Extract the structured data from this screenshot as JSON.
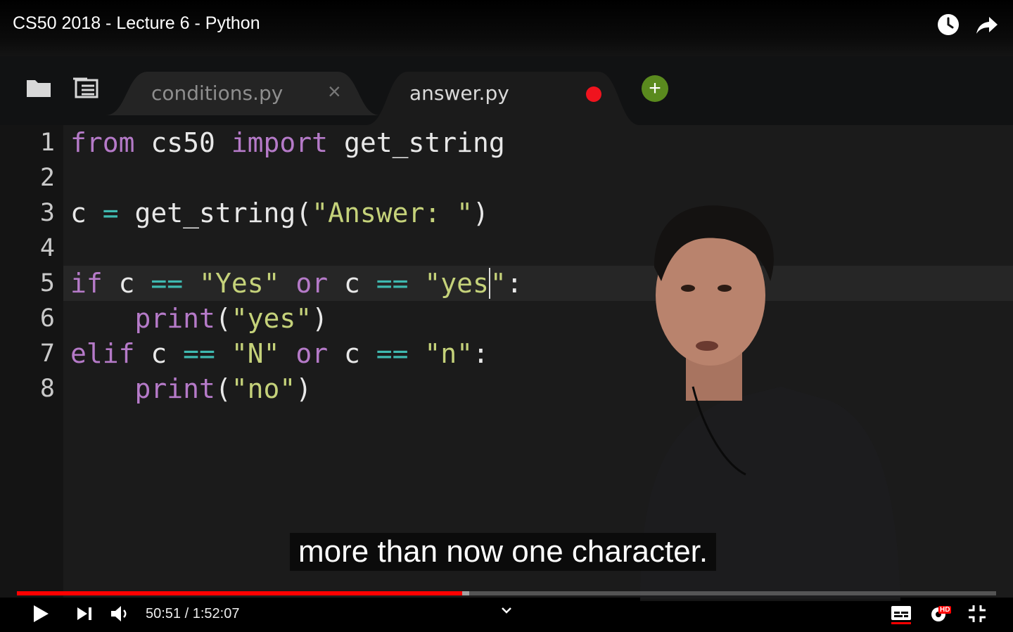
{
  "video": {
    "title": "CS50 2018 - Lecture 6 - Python",
    "caption": "more than now one character.",
    "time_current": "50:51",
    "time_separator": " / ",
    "time_total": "1:52:07",
    "progress_played": 0.455,
    "progress_buffered": 0.462,
    "quality_badge": "HD"
  },
  "ide": {
    "tabs": [
      {
        "label": "conditions.py",
        "close_glyph": "×",
        "active": false
      },
      {
        "label": "answer.py",
        "unsaved": true,
        "active": true
      }
    ],
    "add_tab_glyph": "+",
    "line_numbers": [
      "1",
      "2",
      "3",
      "4",
      "5",
      "6",
      "7",
      "8"
    ]
  },
  "colors": {
    "accent_red": "#ff0000",
    "keyword": "#b57ac8",
    "string": "#c5d27a",
    "operator": "#3fb9b0",
    "add_button": "#5a8a1e"
  },
  "icons": [
    "watch-later-icon",
    "share-icon",
    "folder-icon",
    "outline-icon",
    "play-icon",
    "next-icon",
    "volume-icon",
    "chevron-down-icon",
    "subtitles-icon",
    "settings-icon",
    "exit-fullscreen-icon"
  ]
}
